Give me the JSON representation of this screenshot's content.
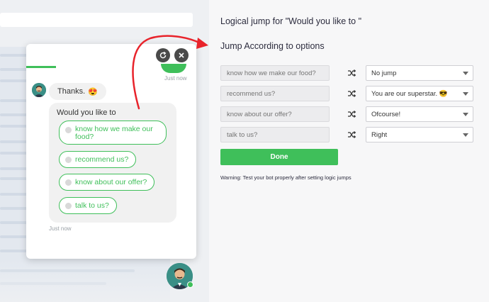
{
  "chat": {
    "sent_time": "Just now",
    "thanks_text": "Thanks.",
    "thanks_emoji": "😍",
    "question": "Would you like to",
    "options": [
      "know how we make our food?",
      "recommend us?",
      "know about our offer?",
      "talk to us?"
    ],
    "bot_time": "Just now"
  },
  "panel": {
    "title": "Logical jump for \"Would you like to \"",
    "subtitle": "Jump According to options",
    "rows": [
      {
        "option": "know how we make our food?",
        "jump": "No jump"
      },
      {
        "option": "recommend us?",
        "jump": "You are our superstar. 😎"
      },
      {
        "option": "know about our offer?",
        "jump": "Ofcourse!"
      },
      {
        "option": "talk to us?",
        "jump": "Right"
      }
    ],
    "done_label": "Done",
    "warning": "Warning: Test your bot properly after setting logic jumps"
  },
  "colors": {
    "accent": "#3fbf5a",
    "arrow": "#e8232b",
    "title_text": "#2c2c3e"
  }
}
